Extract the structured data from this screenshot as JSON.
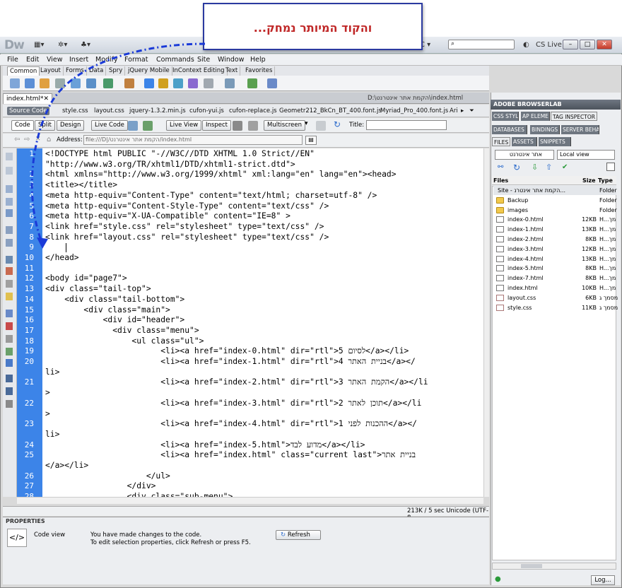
{
  "callout": {
    "text": "והקוד המיותר נמחק..."
  },
  "app": {
    "logo": "Dw",
    "cs_live": "CS Live",
    "search_placeholder": ""
  },
  "menus": [
    "File",
    "Edit",
    "View",
    "Insert",
    "Modify",
    "Format",
    "Commands",
    "Site",
    "Window",
    "Help"
  ],
  "insert_tabs": [
    "Common",
    "Layout",
    "Forms",
    "Data",
    "Spry",
    "jQuery Mobile",
    "InContext Editing",
    "Text",
    "Favorites"
  ],
  "doc": {
    "tab": "index.html*",
    "path": "D:\\הקמת אתר אינטרנט\\index.html"
  },
  "related_files": [
    "Source Code",
    "style.css",
    "layout.css",
    "jquery-1.3.2.min.js",
    "cufon-yui.js",
    "cufon-replace.js",
    "Geometr212_BkCn_BT_400.font.js",
    "Myriad_Pro_400.font.js",
    "Ari"
  ],
  "view": {
    "code": "Code",
    "split": "Split",
    "design": "Design",
    "live_code": "Live Code",
    "live_view": "Live View",
    "inspect": "Inspect",
    "multiscreen": "Multiscreen",
    "title_label": "Title:",
    "title_value": ""
  },
  "address": {
    "label": "Address:",
    "value": "file:///D|/הקמת אתר אינטרנט/index.html"
  },
  "code_lines": [
    {
      "n": "1",
      "text": "<!DOCTYPE html PUBLIC \"-//W3C//DTD XHTML 1.0 Strict//EN\""
    },
    {
      "n": "",
      "text": "\"http://www.w3.org/TR/xhtml1/DTD/xhtml1-strict.dtd\">"
    },
    {
      "n": "2",
      "text": "<html xmlns=\"http://www.w3.org/1999/xhtml\" xml:lang=\"en\" lang=\"en\"><head>"
    },
    {
      "n": "3",
      "text": "<title></title>"
    },
    {
      "n": "4",
      "text": "<meta http-equiv=\"Content-Type\" content=\"text/html; charset=utf-8\" />"
    },
    {
      "n": "5",
      "text": "<meta http-equiv=\"Content-Style-Type\" content=\"text/css\" />"
    },
    {
      "n": "6",
      "text": "<meta http-equiv=\"X-UA-Compatible\" content=\"IE=8\" >"
    },
    {
      "n": "7",
      "text": "<link href=\"style.css\" rel=\"stylesheet\" type=\"text/css\" />"
    },
    {
      "n": "8",
      "text": "<link href=\"layout.css\" rel=\"stylesheet\" type=\"text/css\" />"
    },
    {
      "n": "9",
      "text": ""
    },
    {
      "n": "10",
      "text": "</head>"
    },
    {
      "n": "11",
      "text": ""
    },
    {
      "n": "12",
      "text": "<body id=\"page7\">"
    },
    {
      "n": "13",
      "text": "<div class=\"tail-top\">"
    },
    {
      "n": "14",
      "text": "    <div class=\"tail-bottom\">"
    },
    {
      "n": "15",
      "text": "        <div class=\"main\">"
    },
    {
      "n": "16",
      "text": "            <div id=\"header\">"
    },
    {
      "n": "17",
      "text": "              <div class=\"menu\">"
    },
    {
      "n": "18",
      "text": "                  <ul class=\"ul\">"
    },
    {
      "n": "19",
      "text": "                        <li><a href=\"index-0.html\" dir=\"rtl\">5 לסיום</a></li>"
    },
    {
      "n": "20",
      "text": "                        <li><a href=\"index-1.html\" dir=\"rtl\">4 בניית האתר</a></"
    },
    {
      "n": "",
      "text": "li>"
    },
    {
      "n": "21",
      "text": "                        <li><a href=\"index-2.html\" dir=\"rtl\">3 הקמת האתר</a></li"
    },
    {
      "n": "",
      "text": ">"
    },
    {
      "n": "22",
      "text": "                        <li><a href=\"index-3.html\" dir=\"rtl\">2 תוכן לאתר</a></li"
    },
    {
      "n": "",
      "text": ">"
    },
    {
      "n": "23",
      "text": "                        <li><a href=\"index-4.html\" dir=\"rtl\">1 ההכנות לפני</a></"
    },
    {
      "n": "",
      "text": "li>"
    },
    {
      "n": "24",
      "text": "                        <li><a href=\"index-5.html\">מדוע לבד</a></li>"
    },
    {
      "n": "25",
      "text": "                        <li><a href=\"index.html\" class=\"current last\">בניית אתר"
    },
    {
      "n": "",
      "text": "</a></li>"
    },
    {
      "n": "26",
      "text": "                     </ul>"
    },
    {
      "n": "27",
      "text": "                 </div>"
    },
    {
      "n": "28",
      "text": "                 <div class=\"sub-menu\">"
    }
  ],
  "status": {
    "text": "213K / 5 sec  Unicode (UTF-8"
  },
  "properties": {
    "title": "PROPERTIES",
    "mode": "Code view",
    "msg1": "You have made changes to the code.",
    "msg2": "To edit selection properties, click Refresh or press F5.",
    "refresh": "Refresh"
  },
  "panels": {
    "browserlab": "ADOBE BROWSERLAB",
    "row1": [
      "CSS STYL",
      "AP ELEME",
      "TAG INSPECTOR"
    ],
    "row2": [
      "DATABASES",
      "BINDINGS",
      "SERVER BEHA"
    ],
    "row3": [
      "FILES",
      "ASSETS",
      "SNIPPETS"
    ],
    "site_select": "אתר אינטרנט",
    "view_select": "Local view",
    "cols": {
      "files": "Files",
      "size": "Size",
      "type": "Type"
    },
    "log": "Log..."
  },
  "files": [
    {
      "name": "Site - הקמת אתר אינטרנ...",
      "size": "",
      "type": "Folder",
      "kind": "site"
    },
    {
      "name": "Backup",
      "size": "",
      "type": "Folder",
      "kind": "folder"
    },
    {
      "name": "images",
      "size": "",
      "type": "Folder",
      "kind": "folder"
    },
    {
      "name": "index-0.html",
      "size": "12KB",
      "type": "H...מך",
      "kind": "html"
    },
    {
      "name": "index-1.html",
      "size": "13KB",
      "type": "H...מך",
      "kind": "html"
    },
    {
      "name": "index-2.html",
      "size": "8KB",
      "type": "H...מך",
      "kind": "html"
    },
    {
      "name": "index-3.html",
      "size": "12KB",
      "type": "H...מך",
      "kind": "html"
    },
    {
      "name": "index-4.html",
      "size": "13KB",
      "type": "H...מך",
      "kind": "html"
    },
    {
      "name": "index-5.html",
      "size": "8KB",
      "type": "H...מך",
      "kind": "html"
    },
    {
      "name": "index-7.html",
      "size": "8KB",
      "type": "H...מך",
      "kind": "html"
    },
    {
      "name": "index.html",
      "size": "10KB",
      "type": "H...מך",
      "kind": "html"
    },
    {
      "name": "layout.css",
      "size": "6KB",
      "type": "מסמך ג",
      "kind": "css"
    },
    {
      "name": "style.css",
      "size": "11KB",
      "type": "מסמך ג",
      "kind": "css"
    }
  ]
}
